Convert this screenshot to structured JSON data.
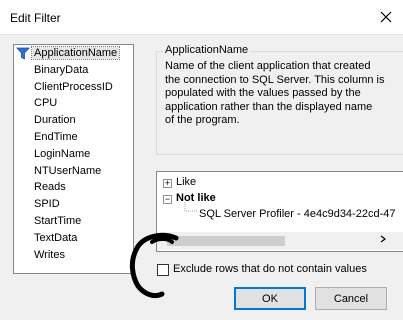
{
  "window": {
    "title": "Edit Filter",
    "close_icon": "close-icon"
  },
  "columns": [
    {
      "label": "ApplicationName",
      "selected": true,
      "icon": "filter-icon"
    },
    {
      "label": "BinaryData"
    },
    {
      "label": "ClientProcessID"
    },
    {
      "label": "CPU"
    },
    {
      "label": "Duration"
    },
    {
      "label": "EndTime"
    },
    {
      "label": "LoginName"
    },
    {
      "label": "NTUserName"
    },
    {
      "label": "Reads"
    },
    {
      "label": "SPID"
    },
    {
      "label": "StartTime"
    },
    {
      "label": "TextData"
    },
    {
      "label": "Writes"
    }
  ],
  "description": {
    "legend": "ApplicationName",
    "lines": [
      "Name of the client application that created",
      "the connection to SQL Server. This column is",
      "populated with the values passed by the",
      "application rather than the displayed name",
      "of the program."
    ]
  },
  "tree": {
    "like": {
      "label": "Like",
      "expander": "+"
    },
    "not_like": {
      "label": "Not like",
      "expander": "−"
    },
    "value": "SQL Server Profiler - 4e4c9d34-22cd-47"
  },
  "exclude": {
    "label": "Exclude rows that do not contain values",
    "checked": false
  },
  "buttons": {
    "ok": "OK",
    "cancel": "Cancel"
  },
  "colors": {
    "accent": "#0078d7",
    "filter_icon": "#2f6fd6"
  }
}
